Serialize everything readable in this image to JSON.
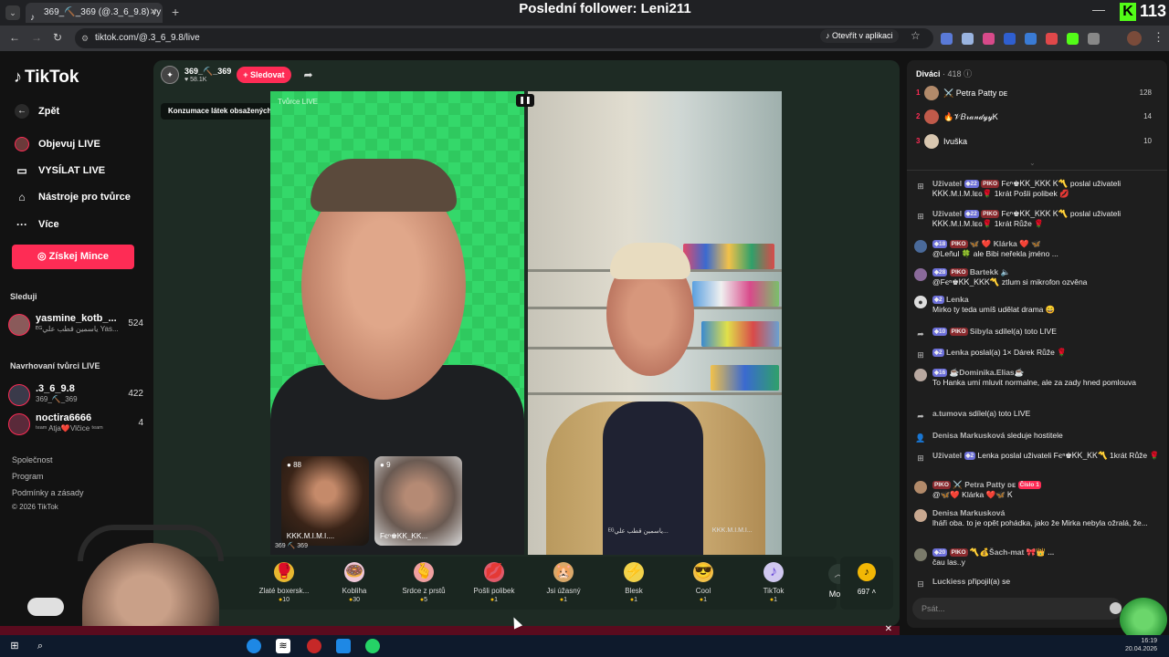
{
  "browser": {
    "tab_title": "369_⛏️_369 (@.3_6_9.8) vy",
    "url": "tiktok.com/@.3_6_9.8/live",
    "open_app_label": "Otevřít v aplikaci"
  },
  "overlay": {
    "stream_title": "Poslední follower: Leni211",
    "kick_count": "113"
  },
  "sidebar": {
    "logo": "TikTok",
    "back": "Zpět",
    "nav": [
      {
        "label": "Objevuj LIVE",
        "icon": "live-avatar-icon"
      },
      {
        "label": "VYSÍLAT LIVE",
        "icon": "camera-icon"
      },
      {
        "label": "Nástroje pro tvůrce",
        "icon": "home-icon"
      },
      {
        "label": "Více",
        "icon": "more-dots-icon"
      }
    ],
    "coins_button": "Získej Mince",
    "following_heading": "Sleduji",
    "following": [
      {
        "name": "yasmine_kotb_...",
        "sub": "ᴱᴳياسمين قطب علي Yas...",
        "count": "524"
      }
    ],
    "suggested_heading": "Navrhovaní tvůrci LIVE",
    "suggested": [
      {
        "name": ".3_6_9.8",
        "sub": "369_⛏️_369",
        "count": "422"
      },
      {
        "name": "noctira6666",
        "sub": "ᵗᵉᵃᵐ Atja❤️Vlčice ᵗᵉᵃᵐ",
        "count": "4"
      }
    ],
    "footer": [
      "Společnost",
      "Program",
      "Podmínky a zásady",
      "© 2026 TikTok"
    ]
  },
  "stream": {
    "host_name": "369_⛏️_369",
    "host_likes": "58.1K",
    "follow_label": "+ Sledovat",
    "warning": "Konzumace látek obsažených v tomto vysílání LIVE m...",
    "left_video_label": "Tvůrce LIVE",
    "guests": [
      {
        "level": "88",
        "name": "ᏦᏦᏦ.M.I.M.I...."
      },
      {
        "level": "9",
        "name": "Fєⁿ♚ᏦᏦ_ᏦᏦ..."
      }
    ],
    "under_left": "369 ⛏️ 369",
    "right_name_a": "ᴱᴳياسمين قطب علي...",
    "right_name_b": "ᏦᏦᏦ.M.I.M.I..."
  },
  "gifts": [
    {
      "name": "Zlaté boxersk...",
      "price": "10",
      "icon": "golden-boxing-gloves-icon",
      "glyph": "🥊"
    },
    {
      "name": "Kobliha",
      "price": "30",
      "icon": "donut-icon",
      "glyph": "🍩"
    },
    {
      "name": "Srdce z prstů",
      "price": "5",
      "icon": "finger-heart-icon",
      "glyph": "🫰"
    },
    {
      "name": "Pošli polibek",
      "price": "1",
      "icon": "kiss-lips-icon",
      "glyph": "💋"
    },
    {
      "name": "Jsi úžasný",
      "price": "1",
      "icon": "hamster-icon",
      "glyph": "🐹"
    },
    {
      "name": "Blesk",
      "price": "1",
      "icon": "lightning-icon",
      "glyph": "⚡"
    },
    {
      "name": "Cool",
      "price": "1",
      "icon": "sunglasses-icon",
      "glyph": "😎"
    },
    {
      "name": "TikTok",
      "price": "1",
      "icon": "tiktok-note-icon",
      "glyph": "♪"
    }
  ],
  "more_label": "More",
  "coin_balance": "697",
  "panel": {
    "viewers_label": "Diváci",
    "viewers_count": "· 418",
    "top_viewers": [
      {
        "rank": "1",
        "name": "⚔️ Petra Patty ᴅᴇ",
        "score": "128",
        "color": "#b28a6a"
      },
      {
        "rank": "2",
        "name": "🔥𝒱𝐵𝓇𝒶𝓃𝒹𝓎𝓎Ꮶ",
        "score": "14",
        "color": "#c05a4a"
      },
      {
        "rank": "3",
        "name": "Ivuška",
        "score": "10",
        "color": "#d8c7b0"
      }
    ],
    "messages": [
      {
        "icon": "gift-box-icon",
        "user": "Uživatel",
        "lvl": "22",
        "pk": "PIKO",
        "text": "Fєⁿ♚ᏦᏦ_ᏦᏦᏦ Ꮶ〽️ poslal uživateli ᏦᏦᏦ.M.I.M.Iᴇɢ🌹 1krát Pošli polibek 💋"
      },
      {
        "icon": "gift-box-icon",
        "user": "Uživatel",
        "lvl": "22",
        "pk": "PIKO",
        "text": "Fєⁿ♚ᏦᏦ_ᏦᏦᏦ Ꮶ〽️ poslal uživateli ᏦᏦᏦ.M.I.M.Iᴇɢ🌹 1krát Růže 🌹"
      },
      {
        "icon": "avatar-icon",
        "user": "🦋 ❤️ Klárka ❤️ 🦋",
        "lvl": "18",
        "pk": "PIKO",
        "text": "@Leňul 🍀 ale Bibi neřekla jméno ..."
      },
      {
        "icon": "avatar-icon",
        "user": "Bartekk 🔈",
        "lvl": "28",
        "pk": "PIKO",
        "text": "@Fєⁿ♚ᏦᏦ_ᏦᏦᏦ〽️ ztlum si mikrofon ozvěna"
      },
      {
        "icon": "avatar-icon",
        "user": "Lenka",
        "lvl": "2",
        "pk": "",
        "text": "Mirko ty teda umíš udělat drama 😄"
      },
      {
        "icon": "share-icon",
        "user": "Sibyla",
        "lvl": "10",
        "pk": "PIKO",
        "text": "sdílel(a) toto LIVE"
      },
      {
        "icon": "gift-box-icon",
        "user": "Lenka",
        "lvl": "2",
        "pk": "",
        "text": "poslal(a) 1× Dárek Růže 🌹"
      },
      {
        "icon": "avatar-icon",
        "user": "☕Dominika.Elias☕",
        "lvl": "16",
        "pk": "",
        "text": "To Hanka umí mluvit normalne, ale za zady hned pomlouva"
      },
      {
        "icon": "share-icon",
        "user": "a.tumova",
        "lvl": "",
        "pk": "",
        "text": "sdílel(a) toto LIVE"
      },
      {
        "icon": "user-icon",
        "user": "Denisa Markusková",
        "lvl": "",
        "pk": "",
        "text": "sleduje hostitele"
      },
      {
        "icon": "gift-box-icon",
        "user": "Uživatel",
        "lvl": "2",
        "pk": "",
        "text": "Lenka poslal uživateli Fєⁿ♚ᏦᏦ_ᏦᏦ〽️ 1krát Růže 🌹"
      },
      {
        "icon": "avatar-icon",
        "user": "⚔️ Petra Patty ᴅᴇ",
        "lvl": "",
        "pk": "PIKO",
        "cislo": "Číslo 1",
        "text": "@🦋❤️ Klárka ❤️🦋 Ꮶ"
      },
      {
        "icon": "avatar-icon",
        "user": "Denisa Markusková",
        "lvl": "",
        "pk": "",
        "text": "lháři oba. to je opět pohádka, jako že Mirka nebyla ožralá, že..."
      },
      {
        "icon": "avatar-icon",
        "user": "〽️💰Šach-mat 🎀👑 ...",
        "lvl": "20",
        "pk": "PIKO",
        "text": "čau las..y"
      },
      {
        "icon": "join-icon",
        "user": "Luckiess",
        "lvl": "",
        "pk": "",
        "text": "připojil(a) se"
      }
    ],
    "input_placeholder": "Psát..."
  },
  "taskbar": {
    "time": "16:19",
    "date": "20.04.2026"
  }
}
